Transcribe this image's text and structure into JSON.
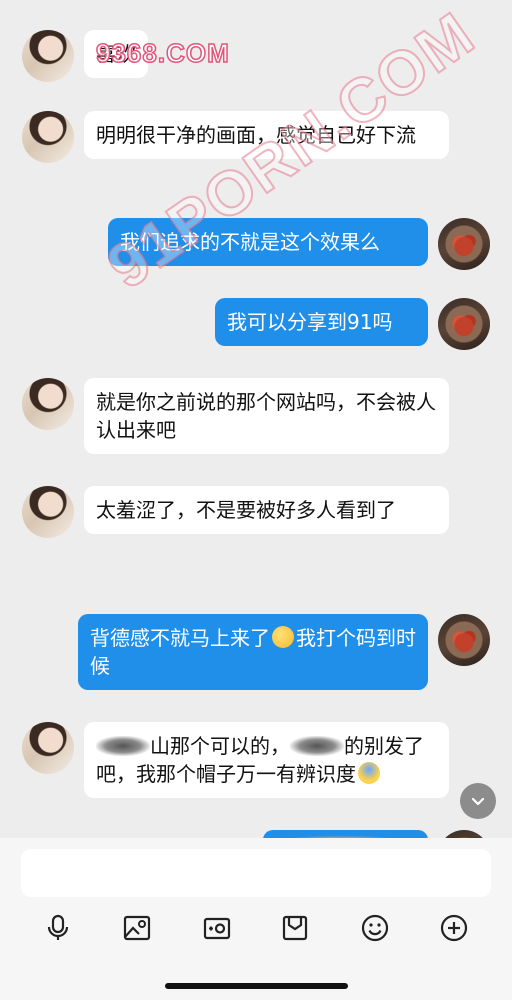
{
  "watermark_top": "9368.COM",
  "watermark_diagonal": "91PORN.COM",
  "messages": [
    {
      "side": "in",
      "text": "喜欢"
    },
    {
      "side": "in",
      "text": "明明很干净的画面，感觉自己好下流"
    },
    {
      "side": "out",
      "text": "我们追求的不就是这个效果么"
    },
    {
      "side": "out",
      "text": "我可以分享到91吗"
    },
    {
      "side": "in",
      "text": "就是你之前说的那个网站吗，不会被人认出来吧"
    },
    {
      "side": "in",
      "text": "太羞涩了，不是要被好多人看到了"
    },
    {
      "side": "out",
      "text_a": "背德感不就马上来了",
      "emoji": "smirking-face",
      "text_b": "我打个码到时候"
    },
    {
      "side": "in",
      "text_a": "山那个可以的，",
      "text_b": "的别发了吧，我那个帽子万一有辨识度",
      "emoji": "screaming-face"
    }
  ],
  "input": {
    "placeholder": ""
  },
  "icons": {
    "scroll": "chevron-down-icon",
    "voice": "microphone-icon",
    "photo": "image-icon",
    "camera": "camera-icon",
    "folder": "folder-icon",
    "emoji": "emoji-icon",
    "plus": "plus-icon"
  },
  "colors": {
    "accent": "#1f8fea",
    "background": "#ededed",
    "incoming": "#ffffff"
  }
}
